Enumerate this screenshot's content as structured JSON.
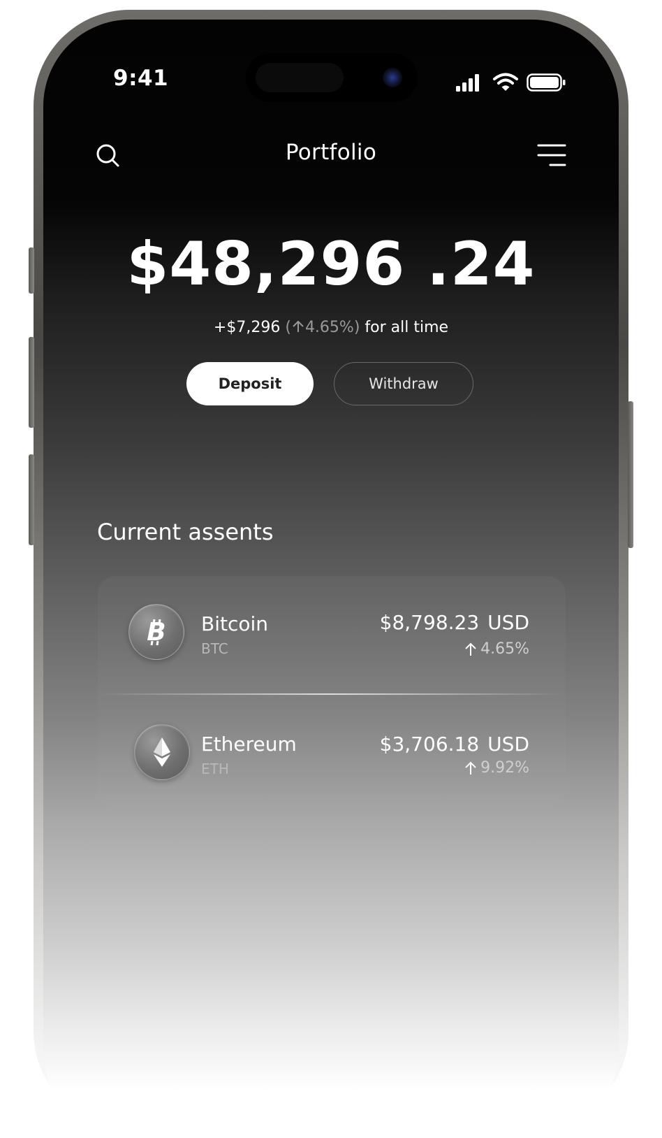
{
  "status_bar": {
    "time": "9:41",
    "signal_icon": "cellular-signal-icon",
    "wifi_icon": "wifi-icon",
    "battery_icon": "battery-icon"
  },
  "header": {
    "title": "Portfolio",
    "search_icon": "search-icon",
    "menu_icon": "menu-icon"
  },
  "balance": {
    "amount": "$48,296 .24",
    "change_amount": "+$7,296",
    "change_open": "(",
    "change_percent": "4.65%",
    "change_close": ")",
    "change_suffix": "for all time"
  },
  "actions": {
    "deposit_label": "Deposit",
    "withdraw_label": "Withdraw"
  },
  "assets_section": {
    "title": "Current assents",
    "items": [
      {
        "name": "Bitcoin",
        "symbol": "BTC",
        "price": "$8,798.23",
        "currency": "USD",
        "change": "4.65%",
        "icon": "bitcoin-icon"
      },
      {
        "name": "Ethereum",
        "symbol": "ETH",
        "price": "$3,706.18",
        "currency": "USD",
        "change": "9.92%",
        "icon": "ethereum-icon"
      }
    ]
  },
  "colors": {
    "background_top": "#050505",
    "background_bottom": "#ffffff",
    "primary_button": "#ffffff",
    "text": "#ffffff",
    "muted_text": "#9a9a9a"
  }
}
